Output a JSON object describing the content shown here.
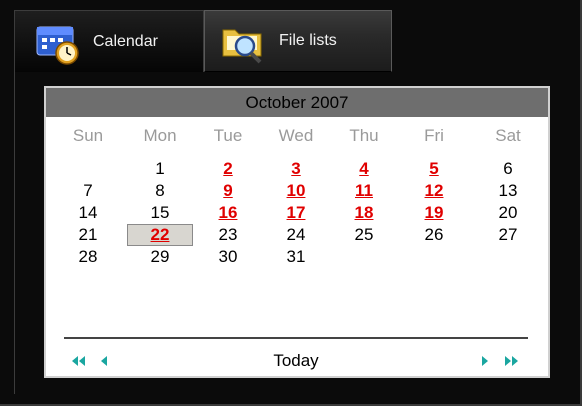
{
  "tabs": [
    {
      "label": "Calendar",
      "icon": "calendar-clock-icon"
    },
    {
      "label": "File lists",
      "icon": "folder-search-icon"
    }
  ],
  "calendar": {
    "month_title": "October 2007",
    "weekdays": [
      "Sun",
      "Mon",
      "Tue",
      "Wed",
      "Thu",
      "Fri",
      "Sat"
    ],
    "weeks": [
      [
        null,
        "1",
        "2",
        "3",
        "4",
        "5",
        "6"
      ],
      [
        "7",
        "8",
        "9",
        "10",
        "11",
        "12",
        "13"
      ],
      [
        "14",
        "15",
        "16",
        "17",
        "18",
        "19",
        "20"
      ],
      [
        "21",
        "22",
        "23",
        "24",
        "25",
        "26",
        "27"
      ],
      [
        "28",
        "29",
        "30",
        "31",
        null,
        null,
        null
      ]
    ],
    "highlighted_days": [
      "2",
      "3",
      "4",
      "5",
      "9",
      "10",
      "11",
      "12",
      "16",
      "17",
      "18",
      "19",
      "22"
    ],
    "selected_day": "22",
    "today_label": "Today",
    "nav": {
      "prev_year": "double-left-arrow-icon",
      "prev_month": "left-arrow-icon",
      "next_month": "right-arrow-icon",
      "next_year": "double-right-arrow-icon"
    },
    "colors": {
      "highlight": "#e00000",
      "nav_arrow": "#1aa6a0",
      "header_bg": "#6e6e6e"
    }
  }
}
